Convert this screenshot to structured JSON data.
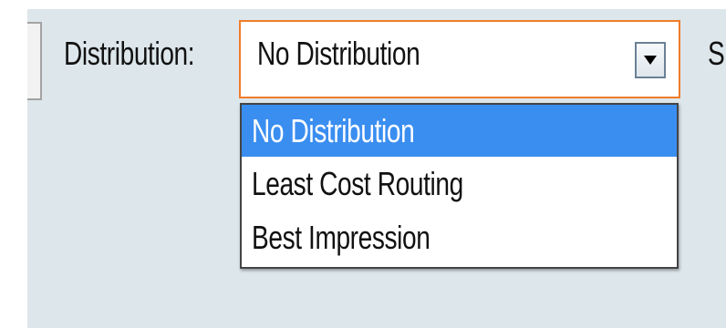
{
  "distribution": {
    "label": "Distribution:",
    "selected_value": "No Distribution",
    "options": [
      {
        "label": "No Distribution",
        "highlighted": true
      },
      {
        "label": "Least Cost Routing",
        "highlighted": false
      },
      {
        "label": "Best Impression",
        "highlighted": false
      }
    ]
  },
  "next_field_label_partial": "S",
  "colors": {
    "panel_background": "#dde6eb",
    "focus_border": "#f07d2a",
    "highlight": "#3a8ef0"
  }
}
